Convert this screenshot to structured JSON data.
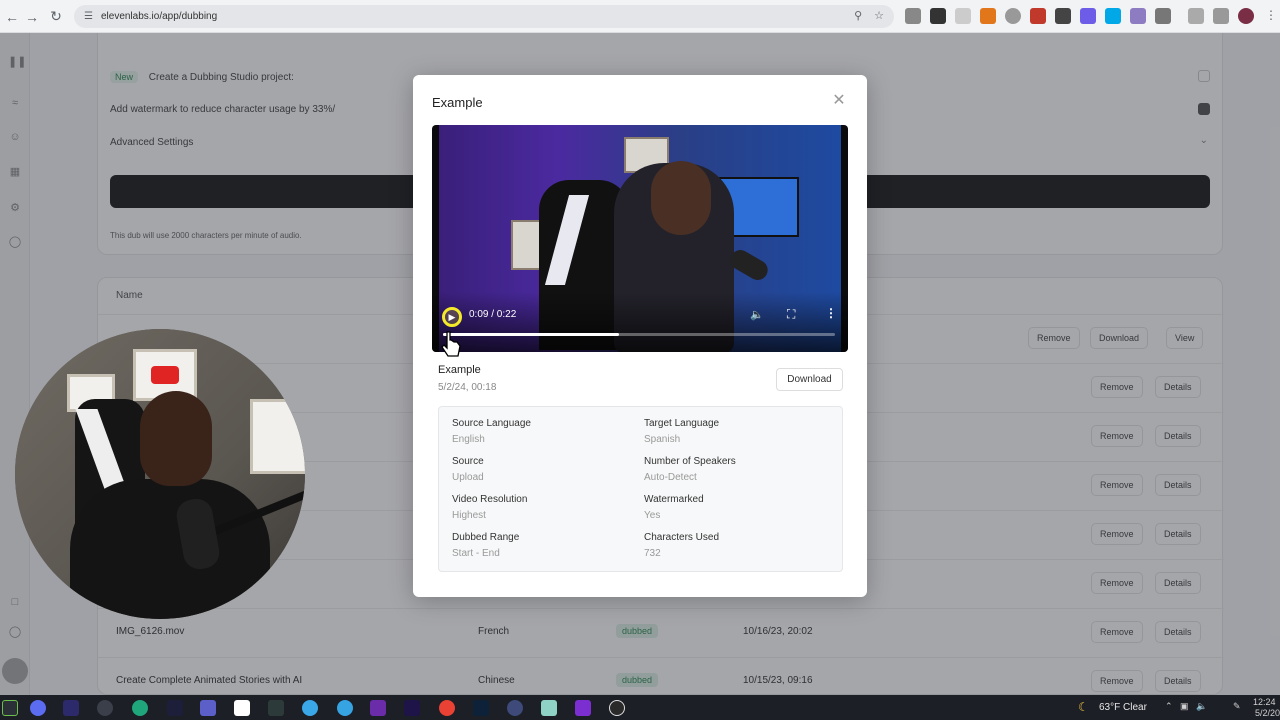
{
  "browser": {
    "url": "elevenlabs.io/app/dubbing"
  },
  "background": {
    "new_badge": "New",
    "dubbing_studio_label": "Create a Dubbing Studio project:",
    "watermark_label": "Add watermark to reduce character usage by 33%/",
    "advanced_settings": "Advanced Settings",
    "char_note": "This dub will use 2000 characters per minute of audio.",
    "table_header_name": "Name",
    "rows": [
      {
        "name": "",
        "lang": "",
        "status": "",
        "date": "",
        "buttons": [
          "Remove",
          "Download",
          "View"
        ]
      },
      {
        "name": "",
        "lang": "",
        "status": "",
        "date": "",
        "buttons": [
          "Remove",
          "Details"
        ]
      },
      {
        "name": "",
        "lang": "",
        "status": "",
        "date": "",
        "buttons": [
          "Remove",
          "Details"
        ]
      },
      {
        "name": "",
        "lang": "",
        "status": "",
        "date": "",
        "buttons": [
          "Remove",
          "Details"
        ]
      },
      {
        "name": "",
        "lang": "",
        "status": "",
        "date": "",
        "buttons": [
          "Remove",
          "Details"
        ]
      },
      {
        "name": "",
        "lang": "",
        "status": "",
        "date": "",
        "buttons": [
          "Remove",
          "Details"
        ]
      },
      {
        "name": "IMG_6126.mov",
        "lang": "French",
        "status": "dubbed",
        "date": "10/16/23, 20:02",
        "buttons": [
          "Remove",
          "Details"
        ]
      },
      {
        "name": "Create Complete Animated Stories with AI",
        "lang": "Chinese",
        "status": "dubbed",
        "date": "10/15/23, 09:16",
        "buttons": [
          "Remove",
          "Details"
        ]
      }
    ]
  },
  "modal": {
    "title": "Example",
    "video": {
      "time": "0:09 / 0:22",
      "progress": 0.45
    },
    "file_title": "Example",
    "file_date": "5/2/24, 00:18",
    "download_label": "Download",
    "info": [
      {
        "label": "Source Language",
        "value": "English"
      },
      {
        "label": "Target Language",
        "value": "Spanish"
      },
      {
        "label": "Source",
        "value": "Upload"
      },
      {
        "label": "Number of Speakers",
        "value": "Auto-Detect"
      },
      {
        "label": "Video Resolution",
        "value": "Highest"
      },
      {
        "label": "Watermarked",
        "value": "Yes"
      },
      {
        "label": "Dubbed Range",
        "value": "Start - End"
      },
      {
        "label": "Characters Used",
        "value": "732"
      }
    ]
  },
  "taskbar": {
    "weather": "63°F  Clear",
    "clock_time": "12:24",
    "clock_date": "5/2/20"
  }
}
